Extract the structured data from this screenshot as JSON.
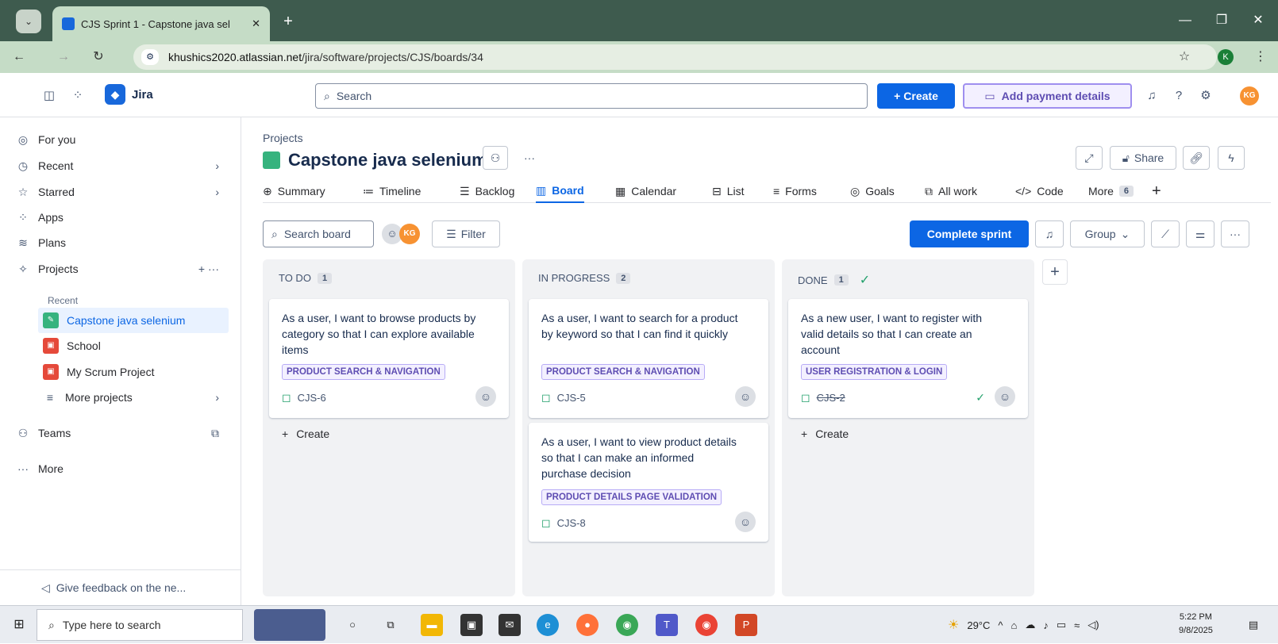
{
  "browser": {
    "tab_title": "CJS Sprint 1 - Capstone java sel",
    "url_host": "khushics2020.atlassian.net",
    "url_path": "/jira/software/projects/CJS/boards/34",
    "profile_initial": "K"
  },
  "topbar": {
    "app_name": "Jira",
    "search_placeholder": "Search",
    "create_label": "Create",
    "payment_label": "Add payment details",
    "user_initials": "KG"
  },
  "sidebar": {
    "items": [
      {
        "label": "For you"
      },
      {
        "label": "Recent"
      },
      {
        "label": "Starred"
      },
      {
        "label": "Apps"
      },
      {
        "label": "Plans"
      },
      {
        "label": "Projects"
      }
    ],
    "recent_heading": "Recent",
    "projects": [
      {
        "label": "Capstone java selenium",
        "color": "#36b37e"
      },
      {
        "label": "School",
        "color": "#e5493a"
      },
      {
        "label": "My Scrum Project",
        "color": "#e5493a"
      }
    ],
    "more_projects": "More projects",
    "teams": "Teams",
    "more": "More",
    "feedback": "Give feedback on the ne..."
  },
  "header": {
    "breadcrumb": "Projects",
    "title": "Capstone java selenium",
    "share_label": "Share"
  },
  "tabs": [
    {
      "label": "Summary"
    },
    {
      "label": "Timeline"
    },
    {
      "label": "Backlog"
    },
    {
      "label": "Board"
    },
    {
      "label": "Calendar"
    },
    {
      "label": "List"
    },
    {
      "label": "Forms"
    },
    {
      "label": "Goals"
    },
    {
      "label": "All work"
    },
    {
      "label": "Code"
    },
    {
      "label": "More",
      "count": "6"
    }
  ],
  "boardbar": {
    "search_placeholder": "Search board",
    "avatar_initials": "KG",
    "filter_label": "Filter",
    "complete_label": "Complete sprint",
    "group_label": "Group"
  },
  "columns": [
    {
      "name": "TO DO",
      "count": "1",
      "cards": [
        {
          "summary": "As a user, I want to browse products by category so that I can explore available items",
          "epic": "PRODUCT SEARCH & NAVIGATION",
          "key": "CJS-6"
        }
      ],
      "create_label": "Create"
    },
    {
      "name": "IN PROGRESS",
      "count": "2",
      "cards": [
        {
          "summary": "As a user, I want to search for a product by keyword so that I can find it quickly",
          "epic": "PRODUCT SEARCH & NAVIGATION",
          "key": "CJS-5"
        },
        {
          "summary": "As a user, I want to view product details so that I can make an informed purchase decision",
          "epic": "PRODUCT DETAILS PAGE VALIDATION",
          "key": "CJS-8"
        }
      ]
    },
    {
      "name": "DONE",
      "count": "1",
      "cards": [
        {
          "summary": "As a new user, I want to register with valid details so that I can create an account",
          "epic": "USER REGISTRATION & LOGIN",
          "key": "CJS-2"
        }
      ],
      "create_label": "Create"
    }
  ],
  "taskbar": {
    "search_placeholder": "Type here to search",
    "temperature": "29°C",
    "time": "5:22 PM",
    "date": "9/8/2025"
  }
}
